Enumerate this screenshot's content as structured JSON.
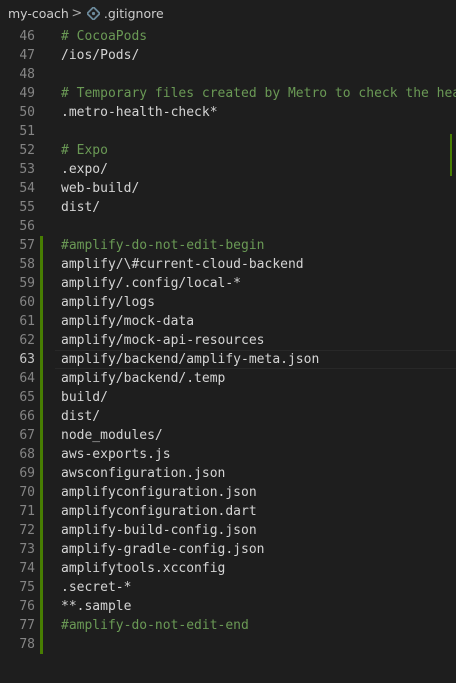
{
  "breadcrumb": {
    "folder": "my-coach",
    "separator": ">",
    "file": ".gitignore",
    "file_icon": "gitignore-icon"
  },
  "editor": {
    "active_line": 63,
    "colors": {
      "background": "#1e1e1e",
      "comment": "#6a9955",
      "text": "#d4d4d4",
      "line_number": "#858585",
      "git_added": "#487e02"
    },
    "lines": [
      {
        "num": "46",
        "text": "# CocoaPods",
        "comment": true,
        "added": false
      },
      {
        "num": "47",
        "text": "/ios/Pods/",
        "comment": false,
        "added": false
      },
      {
        "num": "48",
        "text": "",
        "comment": false,
        "added": false
      },
      {
        "num": "49",
        "text": "# Temporary files created by Metro to check the hea",
        "comment": true,
        "added": false
      },
      {
        "num": "50",
        "text": ".metro-health-check*",
        "comment": false,
        "added": false
      },
      {
        "num": "51",
        "text": "",
        "comment": false,
        "added": false
      },
      {
        "num": "52",
        "text": "# Expo",
        "comment": true,
        "added": false
      },
      {
        "num": "53",
        "text": ".expo/",
        "comment": false,
        "added": false
      },
      {
        "num": "54",
        "text": "web-build/",
        "comment": false,
        "added": false
      },
      {
        "num": "55",
        "text": "dist/",
        "comment": false,
        "added": false
      },
      {
        "num": "56",
        "text": "",
        "comment": false,
        "added": false
      },
      {
        "num": "57",
        "text": "#amplify-do-not-edit-begin",
        "comment": true,
        "added": true
      },
      {
        "num": "58",
        "text": "amplify/\\#current-cloud-backend",
        "comment": false,
        "added": true
      },
      {
        "num": "59",
        "text": "amplify/.config/local-*",
        "comment": false,
        "added": true
      },
      {
        "num": "60",
        "text": "amplify/logs",
        "comment": false,
        "added": true
      },
      {
        "num": "61",
        "text": "amplify/mock-data",
        "comment": false,
        "added": true
      },
      {
        "num": "62",
        "text": "amplify/mock-api-resources",
        "comment": false,
        "added": true
      },
      {
        "num": "63",
        "text": "amplify/backend/amplify-meta.json",
        "comment": false,
        "added": true
      },
      {
        "num": "64",
        "text": "amplify/backend/.temp",
        "comment": false,
        "added": true
      },
      {
        "num": "65",
        "text": "build/",
        "comment": false,
        "added": true
      },
      {
        "num": "66",
        "text": "dist/",
        "comment": false,
        "added": true
      },
      {
        "num": "67",
        "text": "node_modules/",
        "comment": false,
        "added": true
      },
      {
        "num": "68",
        "text": "aws-exports.js",
        "comment": false,
        "added": true
      },
      {
        "num": "69",
        "text": "awsconfiguration.json",
        "comment": false,
        "added": true
      },
      {
        "num": "70",
        "text": "amplifyconfiguration.json",
        "comment": false,
        "added": true
      },
      {
        "num": "71",
        "text": "amplifyconfiguration.dart",
        "comment": false,
        "added": true
      },
      {
        "num": "72",
        "text": "amplify-build-config.json",
        "comment": false,
        "added": true
      },
      {
        "num": "73",
        "text": "amplify-gradle-config.json",
        "comment": false,
        "added": true
      },
      {
        "num": "74",
        "text": "amplifytools.xcconfig",
        "comment": false,
        "added": true
      },
      {
        "num": "75",
        "text": ".secret-*",
        "comment": false,
        "added": true
      },
      {
        "num": "76",
        "text": "**.sample",
        "comment": false,
        "added": true
      },
      {
        "num": "77",
        "text": "#amplify-do-not-edit-end",
        "comment": true,
        "added": true
      },
      {
        "num": "78",
        "text": "",
        "comment": false,
        "added": true
      }
    ]
  }
}
